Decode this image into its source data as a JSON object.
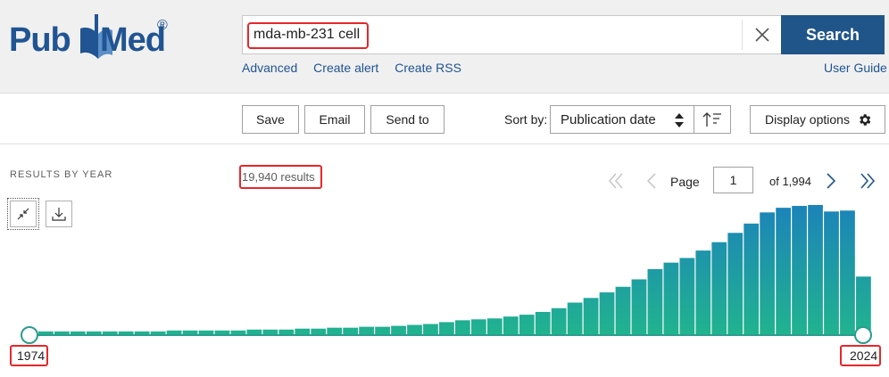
{
  "app": {
    "logo_pub": "Pub",
    "logo_med": "Med",
    "logo_reg": "®"
  },
  "search": {
    "query": "mda-mb-231 cell",
    "button_label": "Search",
    "clear_icon": "close-icon"
  },
  "links": {
    "advanced": "Advanced",
    "create_alert": "Create alert",
    "create_rss": "Create RSS",
    "user_guide": "User Guide"
  },
  "toolbar": {
    "save": "Save",
    "email": "Email",
    "send_to": "Send to",
    "sort_by_label": "Sort by:",
    "sort_value": "Publication date",
    "display_options": "Display options"
  },
  "results": {
    "by_year_label": "RESULTS BY YEAR",
    "count": "19,940 results",
    "page_label": "Page",
    "page_value": "1",
    "page_of": "of 1,994"
  },
  "timeline": {
    "start_year": "1974",
    "end_year": "2024"
  },
  "chart_data": {
    "type": "bar",
    "categories": [
      "1974",
      "1975",
      "1976",
      "1977",
      "1978",
      "1979",
      "1980",
      "1981",
      "1982",
      "1983",
      "1984",
      "1985",
      "1986",
      "1987",
      "1988",
      "1989",
      "1990",
      "1991",
      "1992",
      "1993",
      "1994",
      "1995",
      "1996",
      "1997",
      "1998",
      "1999",
      "2000",
      "2001",
      "2002",
      "2003",
      "2004",
      "2005",
      "2006",
      "2007",
      "2008",
      "2009",
      "2010",
      "2011",
      "2012",
      "2013",
      "2014",
      "2015",
      "2016",
      "2017",
      "2018",
      "2019",
      "2020",
      "2021",
      "2022",
      "2023",
      "2024"
    ],
    "values": [
      3,
      3,
      3,
      3,
      3,
      3,
      3,
      3,
      4,
      4,
      4,
      4,
      4,
      5,
      5,
      5,
      6,
      6,
      7,
      7,
      8,
      8,
      9,
      10,
      11,
      13,
      15,
      16,
      17,
      19,
      21,
      24,
      28,
      34,
      39,
      45,
      51,
      59,
      70,
      77,
      82,
      90,
      99,
      109,
      119,
      131,
      136,
      138,
      139,
      132,
      133,
      62
    ],
    "xlabel": "",
    "ylabel": "",
    "colors": {
      "top": "#1c83b9",
      "bottom": "#21b38f",
      "axis": "#2a9d8f"
    }
  }
}
